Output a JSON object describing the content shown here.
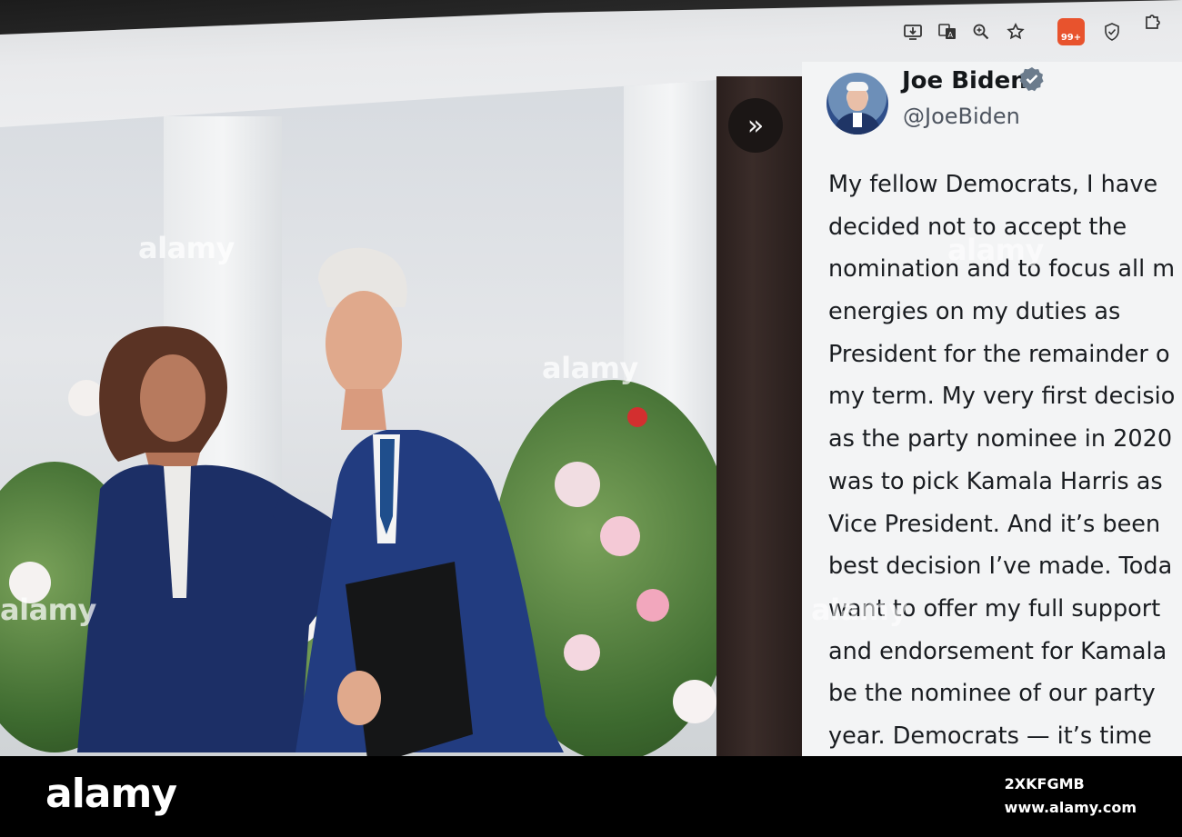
{
  "browser": {
    "icons": [
      "install-icon",
      "translate-icon",
      "zoom-icon",
      "bookmark-star-icon",
      "extension-badge-icon",
      "shield-icon",
      "puzzle-icon"
    ],
    "extension_badge": "99+"
  },
  "tweet": {
    "name": "Joe Biden",
    "handle": "@JoeBiden",
    "lines": [
      "My fellow Democrats, I have",
      "decided not to accept the",
      "nomination and to focus all m",
      "energies on my duties as",
      "President for the remainder o",
      "my term. My very first decisio",
      "as the party nominee in 2020",
      "was to pick Kamala Harris as",
      "Vice President. And it’s been",
      "best decision I’ve made. Toda",
      "want to offer my full support",
      "and endorsement for Kamala",
      "be the nominee of our party",
      "year. Democrats — it’s time"
    ]
  },
  "watermark": "alamy",
  "footer": {
    "logo": "alamy",
    "image_id": "2XKFGMB",
    "site": "www.alamy.com"
  },
  "colors": {
    "extension_badge": "#e8532d",
    "verified_badge": "#6b7b8c",
    "suit_navy": "#1f3566"
  }
}
